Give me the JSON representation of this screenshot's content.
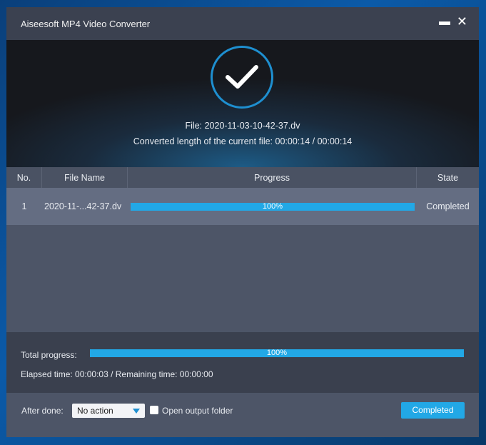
{
  "window": {
    "title": "Aiseesoft MP4 Video Converter"
  },
  "hero": {
    "file_line": "File: 2020-11-03-10-42-37.dv",
    "length_line": "Converted length of the current file: 00:00:14 / 00:00:14"
  },
  "table": {
    "headers": [
      "No.",
      "File Name",
      "Progress",
      "State"
    ],
    "rows": [
      {
        "no": "1",
        "name": "2020-11-...42-37.dv",
        "progress": "100%",
        "progress_value": 100,
        "state": "Completed"
      }
    ]
  },
  "total": {
    "label": "Total progress:",
    "progress": "100%",
    "progress_value": 100,
    "time": "Elapsed time: 00:00:03 / Remaining time: 00:00:00"
  },
  "footer": {
    "after_done_label": "After done:",
    "after_done_value": "No action",
    "open_folder_label": "Open output folder",
    "open_folder_checked": false,
    "button": "Completed"
  },
  "colors": {
    "accent": "#22a8e6"
  }
}
